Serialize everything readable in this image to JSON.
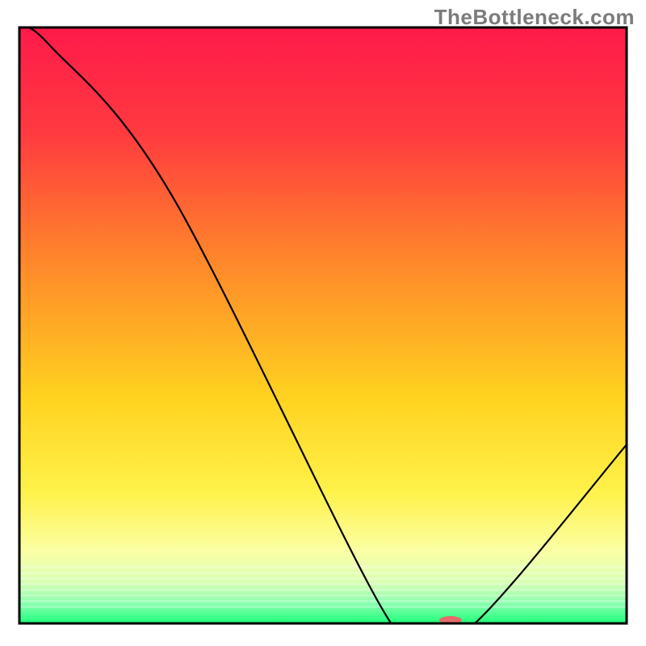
{
  "watermark": "TheBottleneck.com",
  "chart_data": {
    "type": "line",
    "title": "",
    "xlabel": "",
    "ylabel": "",
    "xlim": [
      0,
      100
    ],
    "ylim": [
      0,
      100
    ],
    "grid": false,
    "legend": false,
    "series": [
      {
        "name": "bottleneck-curve",
        "x": [
          0,
          5,
          25,
          60,
          67,
          75,
          100
        ],
        "values": [
          100,
          97,
          72,
          2,
          0,
          0,
          30
        ],
        "stroke": "#000000",
        "stroke_width": 2.2
      }
    ],
    "marker": {
      "name": "optimal-point",
      "x": 71,
      "y": 0,
      "rx": 14,
      "ry": 5,
      "fill": "#e76b6b"
    },
    "background_gradient": {
      "stops": [
        {
          "offset": 0.0,
          "color": "#ff1a4a"
        },
        {
          "offset": 0.18,
          "color": "#ff3b3f"
        },
        {
          "offset": 0.4,
          "color": "#ff8a2a"
        },
        {
          "offset": 0.62,
          "color": "#ffd21f"
        },
        {
          "offset": 0.78,
          "color": "#fff24a"
        },
        {
          "offset": 0.88,
          "color": "#fbffa6"
        },
        {
          "offset": 0.93,
          "color": "#d9ffb3"
        },
        {
          "offset": 0.965,
          "color": "#8dffb0"
        },
        {
          "offset": 1.0,
          "color": "#1fff7a"
        }
      ]
    },
    "frame_color": "#000000",
    "frame_width": 3
  }
}
